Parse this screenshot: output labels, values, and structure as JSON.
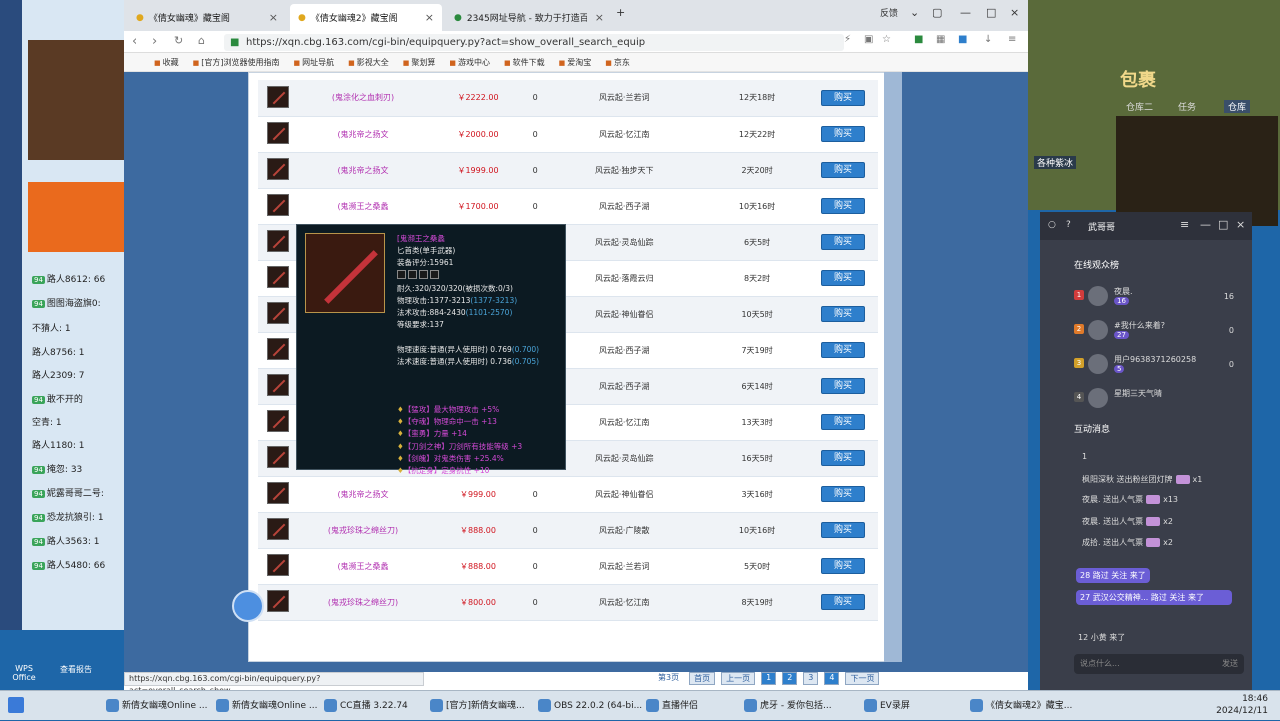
{
  "browser": {
    "tabs": [
      {
        "label": "《倩女幽魂》藏宝阁"
      },
      {
        "label": "《倩女幽魂2》藏宝阁"
      },
      {
        "label": "2345网址导航 - 致力于打造百年"
      }
    ],
    "feedback_label": "反馈",
    "url": "https://xqn.cbg.163.com/cgi-bin/equipquery.py?act=show_overall_search_equip",
    "bookmarks": [
      "收藏",
      "[官方]浏览器使用指南",
      "网址导航",
      "影视大全",
      "聚划算",
      "游戏中心",
      "软件下载",
      "爱淘宝",
      "京东"
    ],
    "status_url": "https://xqn.cbg.163.com/cgi-bin/equipquery.py?act=overall_search_show_..."
  },
  "listing": {
    "buy_label": "购买",
    "rows": [
      {
        "name": "(鬼涂化之血刺刃)",
        "price": "￥2222.00",
        "count": "0",
        "server": "风云起·兰若词",
        "time": "12天18时"
      },
      {
        "name": "(鬼兆帝之扬文",
        "price": "￥2000.00",
        "count": "0",
        "server": "风云起·忆江南",
        "time": "12天22时"
      },
      {
        "name": "(鬼兆帝之扬文",
        "price": "￥1999.00",
        "count": "0",
        "server": "风云起·独步天下",
        "time": "2天20时"
      },
      {
        "name": "(鬼濒王之桑蠡",
        "price": "￥1700.00",
        "count": "0",
        "server": "风云起·西子湖",
        "time": "10天16时"
      },
      {
        "name": "",
        "price": "",
        "count": "0",
        "server": "风云起·灵岛仙踪",
        "time": "6天5时"
      },
      {
        "name": "",
        "price": "",
        "count": "0",
        "server": "风云起·落霞云归",
        "time": "8天2时"
      },
      {
        "name": "",
        "price": "",
        "count": "0",
        "server": "风云起·神仙眷侣",
        "time": "10天5时"
      },
      {
        "name": "",
        "price": "",
        "count": "0",
        "server": "风云起·西子湖",
        "time": "7天19时"
      },
      {
        "name": "",
        "price": "",
        "count": "0",
        "server": "风云起·西子湖",
        "time": "6天14时"
      },
      {
        "name": "",
        "price": "",
        "count": "0",
        "server": "风云起·忆江南",
        "time": "13天3时"
      },
      {
        "name": "",
        "price": "",
        "count": "0",
        "server": "风云起·灵岛仙踪",
        "time": "16天5时"
      },
      {
        "name": "(鬼兆帝之扬文",
        "price": "￥999.00",
        "count": "0",
        "server": "风云起·神仙眷侣",
        "time": "3天16时"
      },
      {
        "name": "(鬼戎珍珠之绵丝刀)",
        "price": "￥888.00",
        "count": "0",
        "server": "风云起·广陵散",
        "time": "10天16时"
      },
      {
        "name": "(鬼濒王之桑蠡",
        "price": "￥888.00",
        "count": "0",
        "server": "风云起·兰若词",
        "time": "5天0时"
      },
      {
        "name": "(鬼戎珍珠之绵丝刀)",
        "price": "￥800.00",
        "count": "0",
        "server": "风云起·忆江南",
        "time": "8天19时"
      }
    ],
    "pager": {
      "info": "第3页",
      "first": "首页",
      "prev": "上一页",
      "pages": [
        "1",
        "2",
        "3",
        "4"
      ],
      "next": "下一页"
    }
  },
  "tooltip": {
    "title": "[鬼濒王之桑蠡",
    "type": "匕首类(单手武器)",
    "score": "装备评分:15961",
    "durability": "耐久:320/320/320(被损次数:0/3)",
    "phys_attack": "物理攻击:1377-3213",
    "phys_attack_hl": "(1377-3213)",
    "magic_attack": "法术攻击:884-2430",
    "magic_attack_hl": "(1101-2570)",
    "level_req": "等级要求:137",
    "phys_speed": "物理速度:普通(异人使用时) 0.769",
    "phys_speed_hl": "(0.700)",
    "magic_speed": "法术速度:普通(异人使用时) 0.736",
    "magic_speed_hl": "(0.705)",
    "effects": [
      "【猛攻】最大物理攻击 +5%",
      "【夺魂】物理命中一击 +13",
      "【蛮勇】力量 +14",
      "【刀剑之神】刀剑所有技能等级 +3",
      "【剑魄】对鬼类伤害 +25.4%",
      "【抗定身】定身抗性 +10"
    ]
  },
  "live": {
    "streamer": "武哥哥",
    "viewers_title": "在线观众榜",
    "viewers": [
      {
        "rank": "1",
        "name": "夜晨.",
        "level": "16",
        "count": "16"
      },
      {
        "rank": "2",
        "name": "#我什么来着?",
        "level": "27",
        "count": "0"
      },
      {
        "rank": "3",
        "name": "用户9638371260258",
        "level": "5",
        "count": "0"
      },
      {
        "rank": "4",
        "name": "星期三天气晴",
        "level": "",
        "count": ""
      }
    ],
    "messages_title": "互动消息",
    "messages": [
      {
        "text": "1",
        "gift": ""
      },
      {
        "text": "枫阳深秋 送出粉丝团灯牌",
        "gift": "x1"
      },
      {
        "text": "夜晨. 送出人气票",
        "gift": "x13"
      },
      {
        "text": "夜晨. 送出人气票",
        "gift": "x2"
      },
      {
        "text": "成拾. 送出人气票",
        "gift": "x2"
      }
    ],
    "highlight1": "28 路过 关注 来了",
    "highlight2": "27 武汉公交精神... 路过 关注 来了",
    "join": "12 小黄 来了",
    "input_placeholder": "说点什么...",
    "send": "发送"
  },
  "left_chat": [
    "路人8612: 66",
    "图图海盗旗0:",
    "不猜人: 1",
    "路人8756: 1",
    "路人2309: 7",
    "敢不开的",
    "空青: 1",
    "路人1180: 1",
    "掩忽: 33",
    "妮露哥哥二号:",
    "恐龙抗狼引: 1",
    "路人3563: 1",
    "路人5480: 66"
  ],
  "desktop_icons": [
    "WPS Office",
    "查看报告"
  ],
  "game": {
    "bag_title": "包裹",
    "tabs": [
      "仓库二",
      "任务",
      "仓库"
    ],
    "npc": "各种紫冰"
  },
  "taskbar": {
    "items": [
      "新倩女幽魂Online ...",
      "新倩女幽魂Online ...",
      "CC直播 3.22.74",
      "[官方]新倩女幽魂...",
      "OBS 22.0.2 (64-bi...",
      "直播伴侣",
      "虎牙 - 爱你包括...",
      "EV录屏",
      "《倩女幽魂2》藏宝..."
    ],
    "time": "18:46",
    "date": "2024/12/11"
  }
}
